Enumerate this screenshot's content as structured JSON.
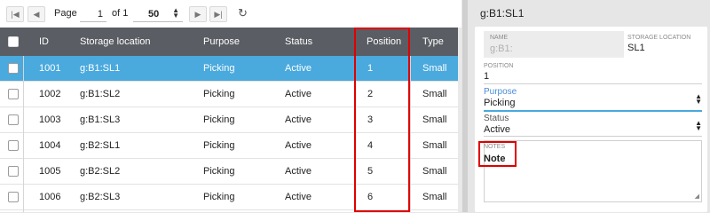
{
  "pager": {
    "first_icon": "first-page-icon",
    "prev_icon": "prev-page-icon",
    "page_label": "Page",
    "page_value": "1",
    "of_label": "of 1",
    "page_size": "50",
    "next_icon": "next-page-icon",
    "last_icon": "last-page-icon",
    "refresh_icon": "refresh-icon"
  },
  "table": {
    "columns": [
      "ID",
      "Storage location",
      "Purpose",
      "Status",
      "Position",
      "Type"
    ],
    "rows": [
      {
        "id": "1001",
        "location": "g:B1:SL1",
        "purpose": "Picking",
        "status": "Active",
        "position": "1",
        "type": "Small",
        "selected": true
      },
      {
        "id": "1002",
        "location": "g:B1:SL2",
        "purpose": "Picking",
        "status": "Active",
        "position": "2",
        "type": "Small"
      },
      {
        "id": "1003",
        "location": "g:B1:SL3",
        "purpose": "Picking",
        "status": "Active",
        "position": "3",
        "type": "Small"
      },
      {
        "id": "1004",
        "location": "g:B2:SL1",
        "purpose": "Picking",
        "status": "Active",
        "position": "4",
        "type": "Small"
      },
      {
        "id": "1005",
        "location": "g:B2:SL2",
        "purpose": "Picking",
        "status": "Active",
        "position": "5",
        "type": "Small"
      },
      {
        "id": "1006",
        "location": "g:B2:SL3",
        "purpose": "Picking",
        "status": "Active",
        "position": "6",
        "type": "Small"
      }
    ]
  },
  "detail": {
    "title": "g:B1:SL1",
    "name_label": "NAME",
    "name_value": "g:B1:",
    "storage_label": "STORAGE LOCATION",
    "storage_value": "SL1",
    "position_label": "POSITION",
    "position_value": "1",
    "purpose_label": "Purpose",
    "purpose_value": "Picking",
    "status_label": "Status",
    "status_value": "Active",
    "notes_label": "NOTES",
    "notes_value": "Note"
  },
  "colors": {
    "header_bg": "#5a5d63",
    "selected_row": "#4aa9dd",
    "highlight_box": "#e00000",
    "focus_underline": "#4aa9dd"
  }
}
